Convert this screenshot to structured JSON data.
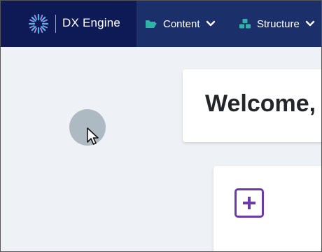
{
  "brand": {
    "name": "DX Engine"
  },
  "nav": {
    "items": [
      {
        "label": "Content",
        "icon": "folder-open-icon"
      },
      {
        "label": "Structure",
        "icon": "cubes-icon"
      }
    ]
  },
  "main": {
    "welcome_title": "Welcome,",
    "add_card_icon": "plus-square-icon"
  },
  "colors": {
    "brand_bg": "#0e1a55",
    "nav_bg": "#1b2f6a",
    "nav_icon": "#2fb5a8",
    "accent_purple": "#6c3aa8",
    "page_bg": "#eef1f5"
  }
}
